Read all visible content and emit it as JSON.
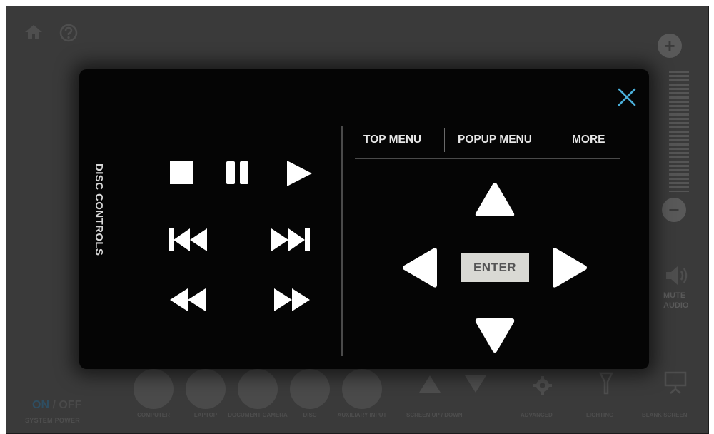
{
  "background": {
    "power": {
      "on": "ON",
      "separator": " / ",
      "off": "OFF",
      "label": "SYSTEM POWER"
    },
    "volume": {
      "plus": "+",
      "minus": "−"
    },
    "mute_label": "MUTE AUDIO",
    "sources": [
      {
        "label": "COMPUTER"
      },
      {
        "label": "LAPTOP"
      },
      {
        "label": "DOCUMENT CAMERA"
      },
      {
        "label": "DISC"
      },
      {
        "label": "AUXILIARY INPUT"
      }
    ],
    "screen_label": "SCREEN UP / DOWN",
    "advanced_label": "ADVANCED",
    "lighting_label": "LIGHTING",
    "blank_label": "BLANK SCREEN"
  },
  "modal": {
    "title": "DISC CONTROLS",
    "menu": {
      "top_menu": "TOP MENU",
      "popup_menu": "POPUP MENU",
      "more": "MORE"
    },
    "enter_label": "ENTER",
    "colors": {
      "close_accent": "#4aaed8",
      "icon_fill": "#ffffff",
      "enter_bg": "#d9d9d4"
    },
    "icons": [
      "stop-icon",
      "pause-icon",
      "play-icon",
      "skip-back-icon",
      "skip-forward-icon",
      "rewind-icon",
      "fast-forward-icon",
      "arrow-up-icon",
      "arrow-left-icon",
      "arrow-right-icon",
      "arrow-down-icon",
      "close-icon"
    ]
  }
}
